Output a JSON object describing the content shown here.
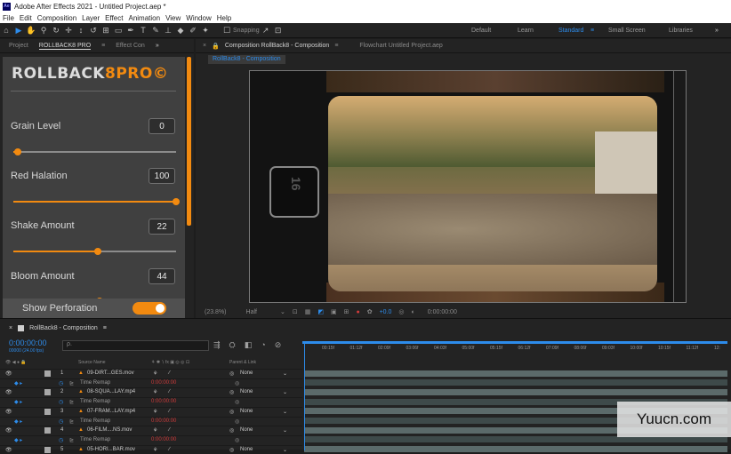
{
  "app": {
    "title": "Adobe After Effects 2021 - Untitled Project.aep *",
    "icon": "Ae"
  },
  "menu": [
    "File",
    "Edit",
    "Composition",
    "Layer",
    "Effect",
    "Animation",
    "View",
    "Window",
    "Help"
  ],
  "toolbar": {
    "snapping": "Snapping",
    "workspaces": [
      "Default",
      "Learn",
      "Standard",
      "Small Screen",
      "Libraries"
    ],
    "active_workspace": "Standard"
  },
  "left_panel": {
    "tabs": [
      "Project",
      "ROLLBACK8 PRO",
      "Effect Con"
    ],
    "plugin": {
      "logo_main": "ROLLBACK",
      "logo_accent": "8PRO©",
      "params": [
        {
          "label": "Grain Level",
          "value": "0",
          "fraction": 0.03
        },
        {
          "label": "Red Halation",
          "value": "100",
          "fraction": 1.0
        },
        {
          "label": "Shake Amount",
          "value": "22",
          "fraction": 0.52
        },
        {
          "label": "Bloom Amount",
          "value": "44",
          "fraction": 0.53
        }
      ],
      "toggle_label": "Show Perforation",
      "toggle_on": true
    }
  },
  "comp": {
    "tabs": [
      "Composition RollBack8 - Composition",
      "Flowchart Untitled Project.aep"
    ],
    "subtab": "RollBack8 - Composition",
    "frame_number": "16",
    "zoom": "(23.8%)",
    "resolution": "Half",
    "exposure": "+0.0",
    "time": "0:00:00:00"
  },
  "timeline": {
    "title": "RollBack8 - Composition",
    "timecode": "0:00:00:00",
    "fps": "00000 (24.00 fps)",
    "search_placeholder": "ρ.",
    "ticks": [
      "00:15f",
      "01:12f",
      "02:09f",
      "03:06f",
      "04:03f",
      "05:00f",
      "05:15f",
      "06:12f",
      "07:09f",
      "08:06f",
      "09:03f",
      "10:00f",
      "10:15f",
      "11:12f",
      "12:"
    ],
    "columns": {
      "source": "Source Name",
      "parent": "Parent & Link"
    },
    "rows": [
      {
        "kind": "layer",
        "num": "1",
        "name": "09-DIRT...GES.mov",
        "mode": "None"
      },
      {
        "kind": "sub",
        "name": "Time Remap",
        "value": "0:00:00:00"
      },
      {
        "kind": "layer",
        "num": "2",
        "name": "08-SQUA...LAY.mp4",
        "mode": "None"
      },
      {
        "kind": "sub",
        "name": "Time Remap",
        "value": "0:00:00:00"
      },
      {
        "kind": "layer",
        "num": "3",
        "name": "07-FRAM...LAY.mp4",
        "mode": "None"
      },
      {
        "kind": "sub",
        "name": "Time Remap",
        "value": "0:00:00:00"
      },
      {
        "kind": "layer",
        "num": "4",
        "name": "06-FILM....NS.mov",
        "mode": "None"
      },
      {
        "kind": "sub",
        "name": "Time Remap",
        "value": "0:00:00:00"
      },
      {
        "kind": "layer",
        "num": "5",
        "name": "05-HORI...BAR.mov",
        "mode": "None"
      }
    ]
  },
  "watermark": "Yuucn.com",
  "colors": {
    "accent": "#f28a10",
    "blue": "#2d8ceb"
  }
}
